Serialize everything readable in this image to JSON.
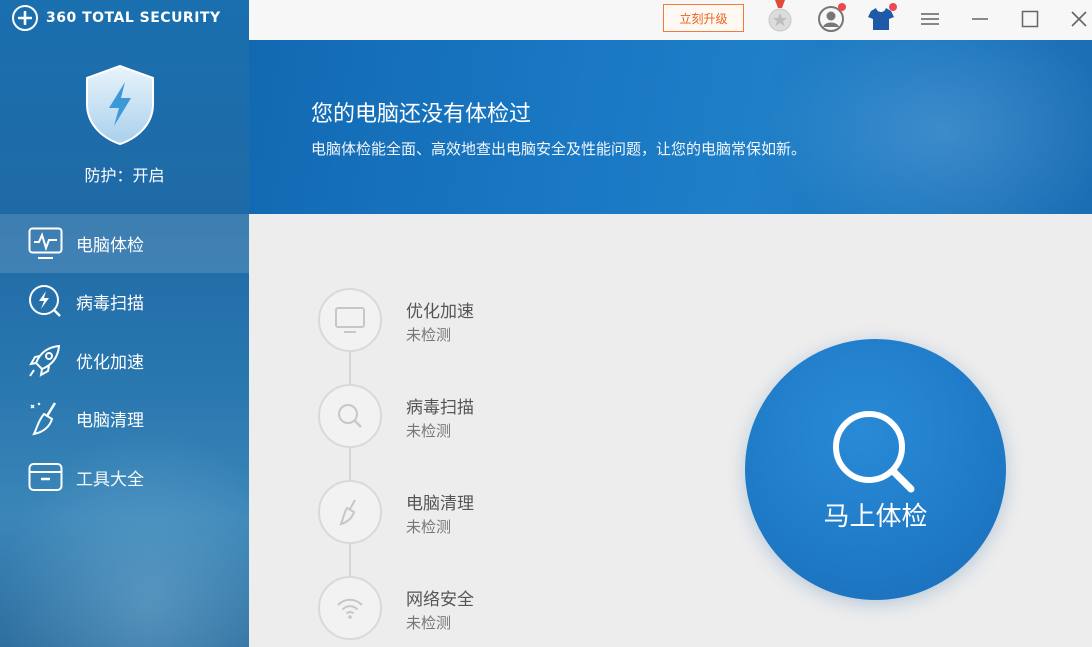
{
  "app": {
    "brand": "360 TOTAL SECURITY"
  },
  "sidebar": {
    "protection_status": "防护：开启",
    "items": [
      {
        "label": "电脑体检",
        "icon": "monitor-pulse-icon",
        "active": true
      },
      {
        "label": "病毒扫描",
        "icon": "lightning-scan-icon",
        "active": false
      },
      {
        "label": "优化加速",
        "icon": "rocket-icon",
        "active": false
      },
      {
        "label": "电脑清理",
        "icon": "broom-icon",
        "active": false
      },
      {
        "label": "工具大全",
        "icon": "toolbox-icon",
        "active": false
      }
    ]
  },
  "titlebar": {
    "upgrade_label": "立刻升级",
    "icons": [
      "medal-icon",
      "user-avatar-icon",
      "skin-shirt-icon",
      "menu-icon",
      "minimize-icon",
      "maximize-icon",
      "close-icon"
    ]
  },
  "banner": {
    "title": "您的电脑还没有体检过",
    "subtitle": "电脑体检能全面、高效地查出电脑安全及性能问题，让您的电脑常保如新。"
  },
  "checks": [
    {
      "title": "优化加速",
      "status": "未检测",
      "icon": "monitor-icon"
    },
    {
      "title": "病毒扫描",
      "status": "未检测",
      "icon": "search-icon"
    },
    {
      "title": "电脑清理",
      "status": "未检测",
      "icon": "broom-icon"
    },
    {
      "title": "网络安全",
      "status": "未检测",
      "icon": "wifi-icon"
    }
  ],
  "scan_button": {
    "label": "马上体检",
    "icon": "magnifier-icon"
  },
  "colors": {
    "accent": "#1f7bc8",
    "upgrade": "#e8641f",
    "badge": "#f0484f"
  }
}
